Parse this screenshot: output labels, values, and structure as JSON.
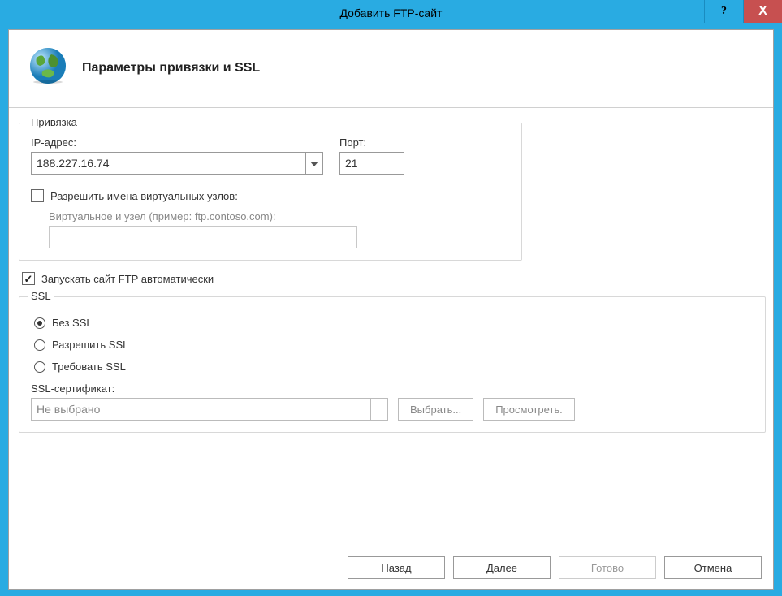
{
  "window": {
    "title": "Добавить FTP-сайт",
    "help_glyph": "?",
    "close_glyph": "X"
  },
  "header": {
    "title": "Параметры привязки и SSL"
  },
  "binding": {
    "legend": "Привязка",
    "ip_label": "IP-адрес:",
    "ip_value": "188.227.16.74",
    "port_label": "Порт:",
    "port_value": "21",
    "allow_virtual_label": "Разрешить имена виртуальных узлов:",
    "allow_virtual_checked": false,
    "virtual_host_label": "Виртуальное и узел (пример: ftp.contoso.com):",
    "virtual_host_value": ""
  },
  "autostart": {
    "label": "Запускать сайт FTP автоматически",
    "checked": true
  },
  "ssl": {
    "legend": "SSL",
    "options": [
      {
        "label": "Без SSL",
        "selected": true
      },
      {
        "label": "Разрешить SSL",
        "selected": false
      },
      {
        "label": "Требовать SSL",
        "selected": false
      }
    ],
    "cert_label": "SSL-сертификат:",
    "cert_value": "Не выбрано",
    "select_btn": "Выбрать...",
    "view_btn": "Просмотреть."
  },
  "footer": {
    "back": "Назад",
    "next": "Далее",
    "finish": "Готово",
    "cancel": "Отмена"
  }
}
